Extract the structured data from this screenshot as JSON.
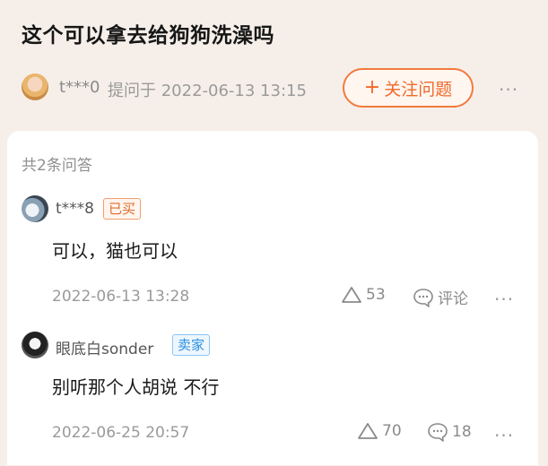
{
  "question": {
    "title": "这个可以拿去给狗狗洗澡吗",
    "asker": "t***0",
    "ask_time": "提问于 2022-06-13 13:15",
    "follow_button": "关注问题",
    "follow_plus": "+",
    "more": "···"
  },
  "answers_section": {
    "count_label": "共2条问答",
    "answers": [
      {
        "user": "t***8",
        "tag": "已买",
        "text": "可以，猫也可以",
        "time": "2022-06-13 13:28",
        "likes": "53",
        "comment_label": "评论",
        "more": "···"
      },
      {
        "user": "眼底白sonder",
        "tag": "卖家",
        "text": "别听那个人胡说 不行",
        "time": "2022-06-25 20:57",
        "likes": "70",
        "comment_label": "18",
        "more": "···"
      }
    ]
  },
  "colors": {
    "accent": "#f2692a",
    "seller_tag": "#2a8fe0",
    "background": "#f6efe9"
  },
  "icons": [
    "avatar",
    "like-triangle-icon",
    "comment-bubble-icon",
    "more-dots-icon"
  ]
}
